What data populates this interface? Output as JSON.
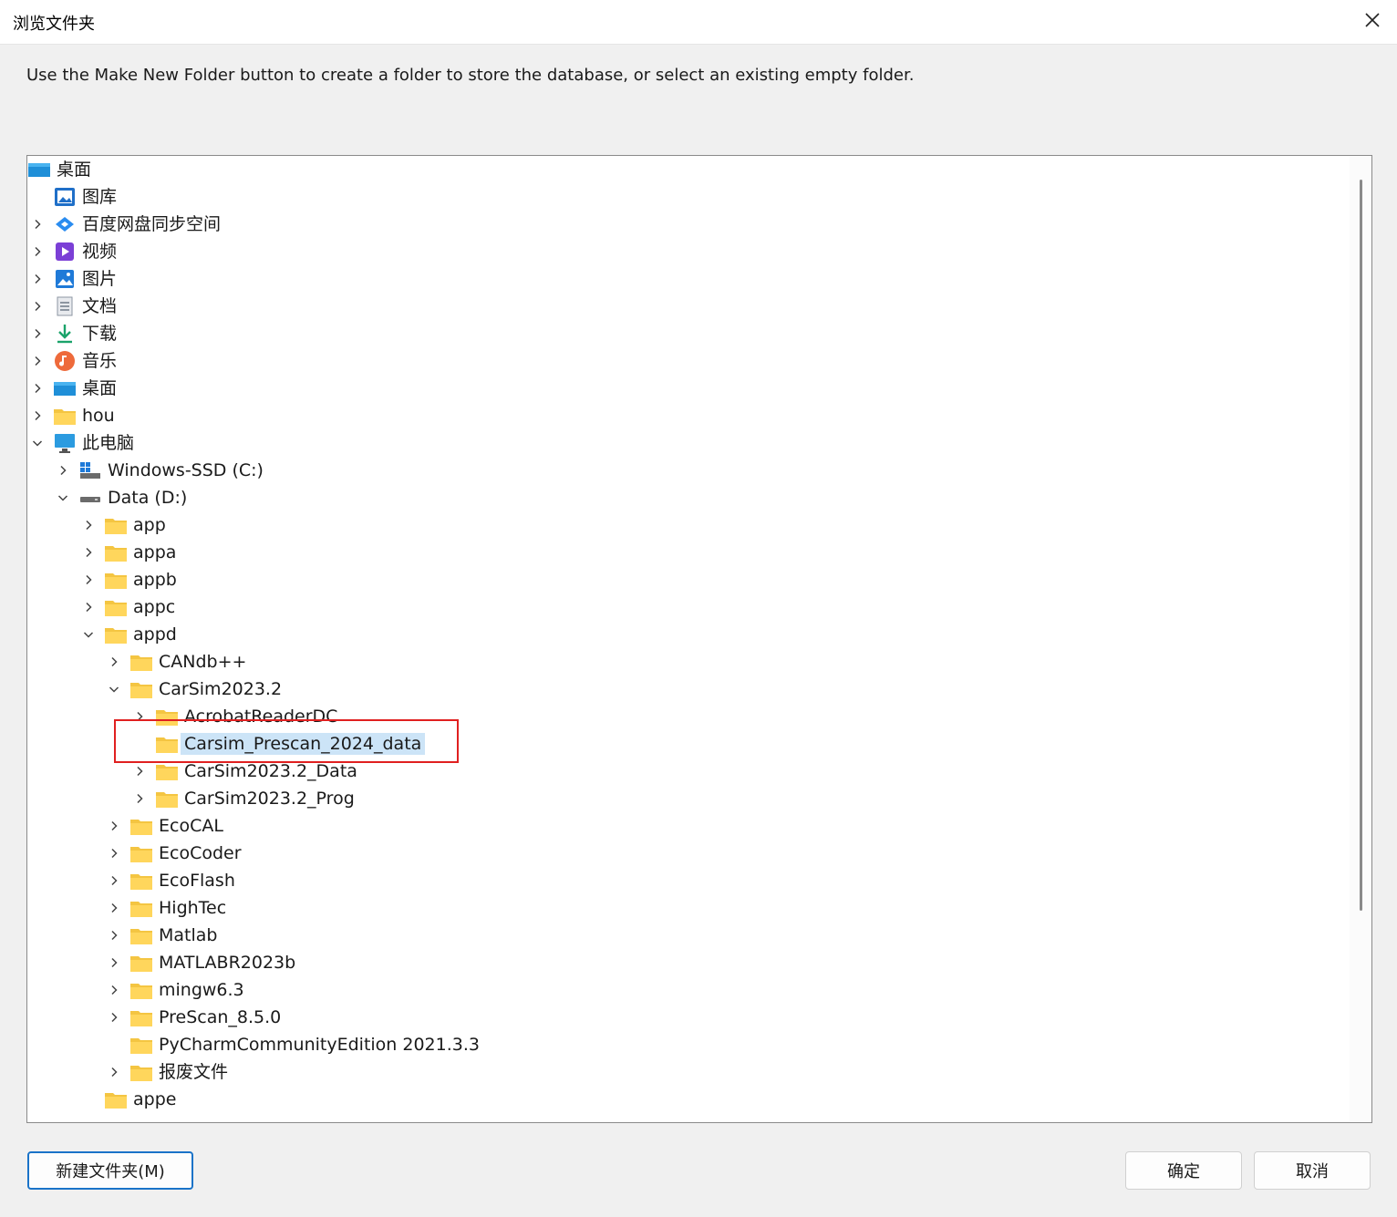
{
  "window": {
    "title": "浏览文件夹",
    "close_icon": "close-icon"
  },
  "instruction": "Use the Make New Folder button to create a folder to store the database, or select an existing empty folder.",
  "tree": {
    "rows": [
      {
        "label": "桌面",
        "level": 0,
        "chevron": "none",
        "icon": "desktop-icon",
        "selected": false
      },
      {
        "label": "图库",
        "level": 1,
        "chevron": "none",
        "icon": "gallery-icon",
        "selected": false
      },
      {
        "label": "百度网盘同步空间",
        "level": 1,
        "chevron": "right",
        "icon": "baidu-netdisk-icon",
        "selected": false
      },
      {
        "label": "视频",
        "level": 1,
        "chevron": "right",
        "icon": "video-icon",
        "selected": false
      },
      {
        "label": "图片",
        "level": 1,
        "chevron": "right",
        "icon": "pictures-icon",
        "selected": false
      },
      {
        "label": "文档",
        "level": 1,
        "chevron": "right",
        "icon": "documents-icon",
        "selected": false
      },
      {
        "label": "下载",
        "level": 1,
        "chevron": "right",
        "icon": "download-icon",
        "selected": false
      },
      {
        "label": "音乐",
        "level": 1,
        "chevron": "right",
        "icon": "music-icon",
        "selected": false
      },
      {
        "label": "桌面",
        "level": 1,
        "chevron": "right",
        "icon": "desktop-icon",
        "selected": false
      },
      {
        "label": "hou",
        "level": 1,
        "chevron": "right",
        "icon": "folder-icon",
        "selected": false
      },
      {
        "label": "此电脑",
        "level": 1,
        "chevron": "down",
        "icon": "computer-icon",
        "selected": false
      },
      {
        "label": "Windows-SSD (C:)",
        "level": 2,
        "chevron": "right",
        "icon": "windows-drive-icon",
        "selected": false
      },
      {
        "label": "Data (D:)",
        "level": 2,
        "chevron": "down",
        "icon": "drive-icon",
        "selected": false
      },
      {
        "label": "app",
        "level": 3,
        "chevron": "right",
        "icon": "folder-icon",
        "selected": false
      },
      {
        "label": "appa",
        "level": 3,
        "chevron": "right",
        "icon": "folder-icon",
        "selected": false
      },
      {
        "label": "appb",
        "level": 3,
        "chevron": "right",
        "icon": "folder-icon",
        "selected": false
      },
      {
        "label": "appc",
        "level": 3,
        "chevron": "right",
        "icon": "folder-icon",
        "selected": false
      },
      {
        "label": "appd",
        "level": 3,
        "chevron": "down",
        "icon": "folder-icon",
        "selected": false
      },
      {
        "label": "CANdb++",
        "level": 4,
        "chevron": "right",
        "icon": "folder-icon",
        "selected": false
      },
      {
        "label": "CarSim2023.2",
        "level": 4,
        "chevron": "down",
        "icon": "folder-icon",
        "selected": false
      },
      {
        "label": "AcrobatReaderDC",
        "level": 5,
        "chevron": "right",
        "icon": "folder-icon",
        "selected": false
      },
      {
        "label": "Carsim_Prescan_2024_data",
        "level": 5,
        "chevron": "none",
        "icon": "folder-icon",
        "selected": true
      },
      {
        "label": "CarSim2023.2_Data",
        "level": 5,
        "chevron": "right",
        "icon": "folder-icon",
        "selected": false
      },
      {
        "label": "CarSim2023.2_Prog",
        "level": 5,
        "chevron": "right",
        "icon": "folder-icon",
        "selected": false
      },
      {
        "label": "EcoCAL",
        "level": 4,
        "chevron": "right",
        "icon": "folder-icon",
        "selected": false
      },
      {
        "label": "EcoCoder",
        "level": 4,
        "chevron": "right",
        "icon": "folder-icon",
        "selected": false
      },
      {
        "label": "EcoFlash",
        "level": 4,
        "chevron": "right",
        "icon": "folder-icon",
        "selected": false
      },
      {
        "label": "HighTec",
        "level": 4,
        "chevron": "right",
        "icon": "folder-icon",
        "selected": false
      },
      {
        "label": "Matlab",
        "level": 4,
        "chevron": "right",
        "icon": "folder-icon",
        "selected": false
      },
      {
        "label": "MATLABR2023b",
        "level": 4,
        "chevron": "right",
        "icon": "folder-icon",
        "selected": false
      },
      {
        "label": "mingw6.3",
        "level": 4,
        "chevron": "right",
        "icon": "folder-icon",
        "selected": false
      },
      {
        "label": "PreScan_8.5.0",
        "level": 4,
        "chevron": "right",
        "icon": "folder-icon",
        "selected": false
      },
      {
        "label": "PyCharmCommunityEdition 2021.3.3",
        "level": 4,
        "chevron": "none",
        "icon": "folder-icon",
        "selected": false
      },
      {
        "label": "报废文件",
        "level": 4,
        "chevron": "right",
        "icon": "folder-icon",
        "selected": false
      },
      {
        "label": "appe",
        "level": 3,
        "chevron": "none",
        "icon": "folder-icon",
        "selected": false
      }
    ]
  },
  "buttons": {
    "new_folder": "新建文件夹(M)",
    "ok": "确定",
    "cancel": "取消"
  },
  "colors": {
    "selection": "#cce4f7",
    "annotation_box": "#e02020",
    "folder": "#ffd65c",
    "primary_border": "#1a73c8"
  }
}
